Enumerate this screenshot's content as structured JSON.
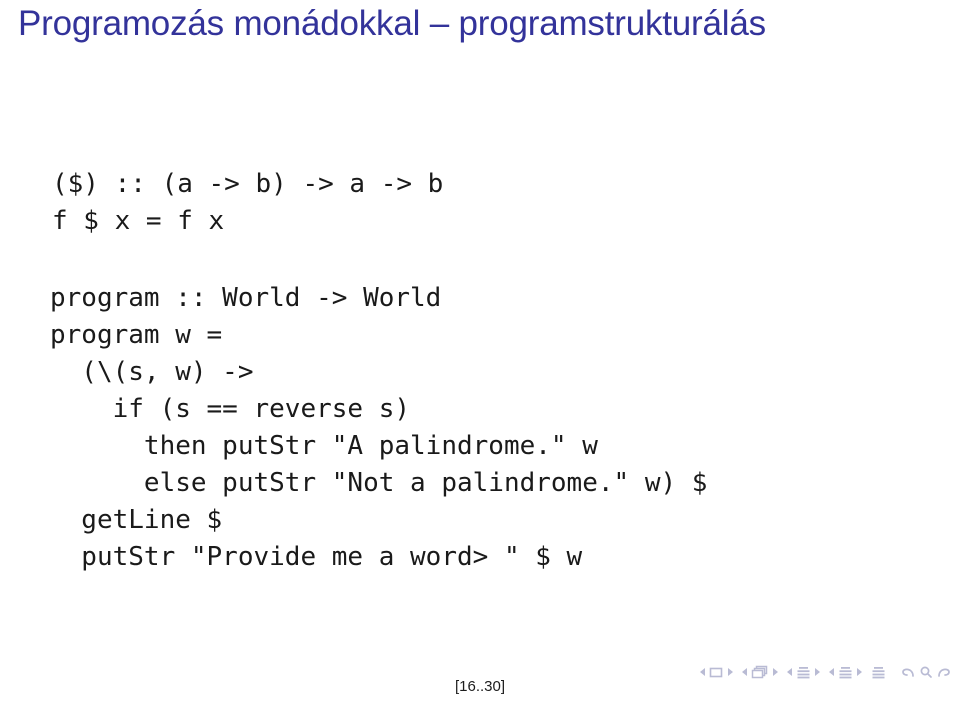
{
  "slide": {
    "title": "Programozás monádokkal – programstrukturálás",
    "title_color": "#33339a",
    "page_label": "[16..30]",
    "code_color": "#1a1a1a",
    "background": "#ffffff"
  },
  "code_blocks": [
    {
      "id": "dollar-operator",
      "lines": [
        "($) :: (a -> b) -> a -> b",
        "f $ x = f x"
      ]
    },
    {
      "id": "program-definition",
      "lines": [
        "program :: World -> World",
        "program w =",
        "  (\\(s, w) ->",
        "    if (s == reverse s)",
        "      then putStr \"A palindrome.\" w",
        "      else putStr \"Not a palindrome.\" w) $",
        "  getLine $",
        "  putStr \"Provide me a word> \" $ w"
      ]
    }
  ],
  "navigation": {
    "color": "#b9bbd4",
    "groups": [
      {
        "name": "slide",
        "icon": "single-frame-icon",
        "prev": "previous-slide",
        "next": "next-slide"
      },
      {
        "name": "frame",
        "icon": "stacked-frames-icon",
        "prev": "previous-frame",
        "next": "next-frame"
      },
      {
        "name": "subsection",
        "icon": "subsection-lines-icon",
        "prev": "previous-subsection",
        "next": "next-subsection"
      },
      {
        "name": "section",
        "icon": "section-lines-icon",
        "prev": "previous-section",
        "next": "next-section"
      }
    ],
    "document_icon": "document-lines-icon",
    "back_icon": "back-arrow-icon",
    "search_icon": "search-icon",
    "forward_icon": "forward-arrow-icon"
  }
}
